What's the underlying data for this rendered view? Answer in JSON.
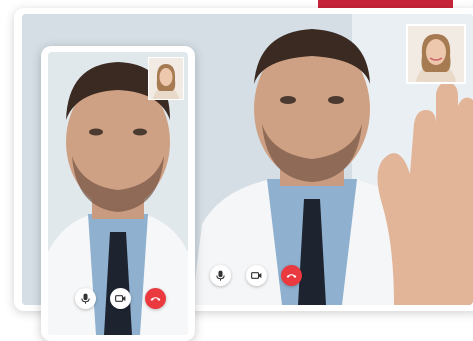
{
  "colors": {
    "banner": "#c8233a",
    "end_call": "#ea3a3f",
    "control_bg": "#ffffff",
    "icon_dark": "#333333"
  },
  "desktop_call": {
    "controls": [
      {
        "icon": "microphone-icon"
      },
      {
        "icon": "video-camera-icon"
      },
      {
        "icon": "end-call-icon"
      }
    ]
  },
  "mobile_call": {
    "controls": [
      {
        "icon": "microphone-icon"
      },
      {
        "icon": "video-camera-icon"
      },
      {
        "icon": "end-call-icon"
      }
    ]
  }
}
